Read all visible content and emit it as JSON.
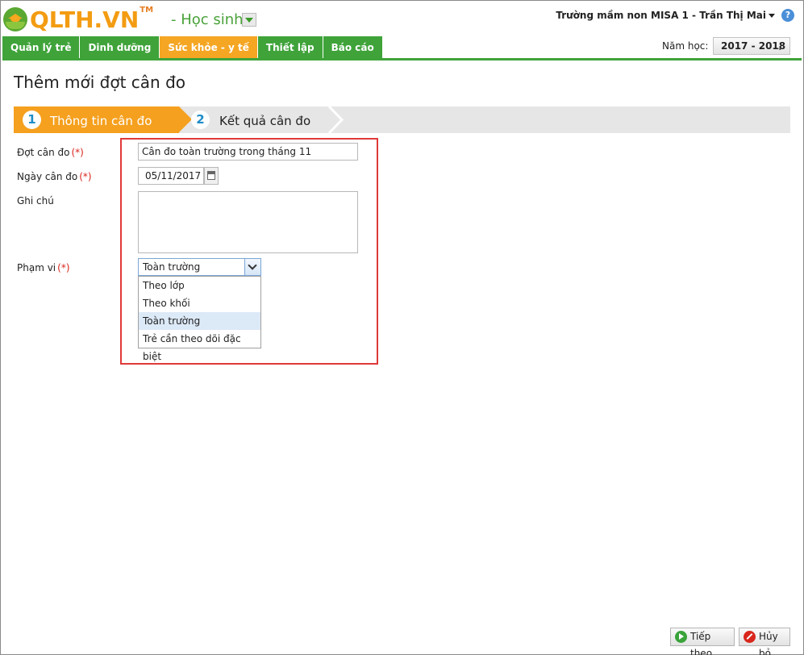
{
  "header": {
    "logo_text": "QLTH.VN",
    "logo_tm": "TM",
    "module": "- Học sinh",
    "user": "Trường mầm non MISA 1 - Trần Thị Mai",
    "help": "?"
  },
  "nav": {
    "items": [
      "Quản lý trẻ",
      "Dinh dưỡng",
      "Sức khỏe - y tế",
      "Thiết lập",
      "Báo cáo"
    ],
    "active_index": 2
  },
  "year": {
    "label": "Năm học:",
    "value": "2017 - 2018"
  },
  "page": {
    "title": "Thêm mới đợt cân đo"
  },
  "steps": [
    {
      "num": "1",
      "label": "Thông tin cân đo"
    },
    {
      "num": "2",
      "label": "Kết quả cân đo"
    }
  ],
  "form": {
    "dot_can_do": {
      "label": "Đợt cân đo",
      "required": "(*)",
      "value": "Cân đo toàn trường trong tháng 11"
    },
    "ngay_can_do": {
      "label": "Ngày cân đo",
      "required": "(*)",
      "value": "05/11/2017"
    },
    "ghi_chu": {
      "label": "Ghi chú",
      "value": ""
    },
    "pham_vi": {
      "label": "Phạm vi",
      "required": "(*)",
      "value": "Toàn trường",
      "options": [
        "Theo lớp",
        "Theo khối",
        "Toàn trường",
        "Trẻ cần theo dõi đặc biệt"
      ],
      "highlighted_index": 2
    }
  },
  "buttons": {
    "next": "Tiếp theo",
    "cancel": "Hủy bỏ"
  },
  "colors": {
    "brand_green": "#3fa33a",
    "brand_orange": "#f5a623",
    "highlight_red": "#e03a3a"
  }
}
